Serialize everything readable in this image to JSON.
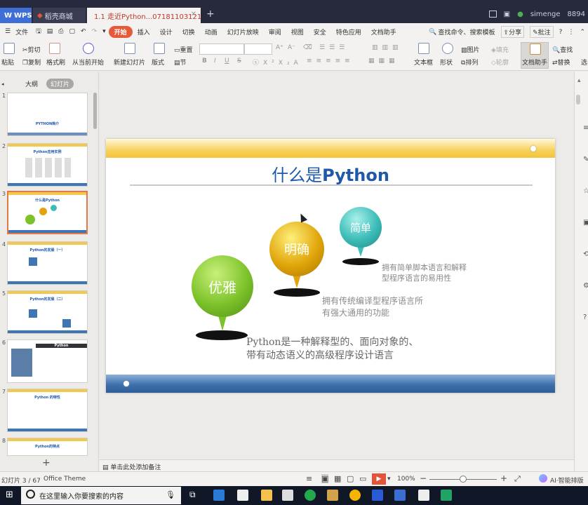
{
  "titlebar": {
    "tabs": [
      {
        "label": "WPS"
      },
      {
        "label": "稻壳商城"
      },
      {
        "label": "1.1 走近Python...07181103121"
      }
    ],
    "new_tab": "+",
    "user": "simenge",
    "user_id": "8894"
  },
  "menubar": {
    "file": "文件",
    "items": [
      "开始",
      "插入",
      "设计",
      "切换",
      "动画",
      "幻灯片放映",
      "审阅",
      "视图",
      "安全",
      "特色应用",
      "文档助手"
    ],
    "search": "查找命令、搜索模板",
    "share": "分享",
    "comment": "批注",
    "help": "?"
  },
  "ribbon": {
    "paste": "粘贴",
    "cut": "剪切",
    "copy": "复制",
    "format_painter": "格式刷",
    "from_start": "从当前开始",
    "new_slide": "新建幻灯片",
    "layout": "版式",
    "reset": "重置",
    "section": "节",
    "bold": "B",
    "italic": "I",
    "underline": "U",
    "strike": "S",
    "textbox": "文本框",
    "shape": "形状",
    "picture": "图片",
    "arrange": "排列",
    "fill": "填充",
    "outline": "轮廓",
    "doc_helper": "文档助手",
    "find": "查找",
    "replace": "替换",
    "more": "选"
  },
  "leftpanel": {
    "tab_outline": "大纲",
    "tab_slides": "幻灯片",
    "add": "+",
    "thumbs": [
      {
        "num": "1",
        "title": "PYTHON简介"
      },
      {
        "num": "2",
        "title": "Python应用实例"
      },
      {
        "num": "3",
        "title": "什么是Python"
      },
      {
        "num": "4",
        "title": "Python的发展（一）"
      },
      {
        "num": "5",
        "title": "Python的发展（二）"
      },
      {
        "num": "6",
        "title": "Python"
      },
      {
        "num": "7",
        "title": "Python 的特性"
      },
      {
        "num": "8",
        "title": "Python的特点"
      }
    ]
  },
  "slide": {
    "title_cn": "什么是",
    "title_en": "Python",
    "pins": [
      {
        "label": "优雅",
        "color": "#7cc22a"
      },
      {
        "label": "明确",
        "color": "#e0a50a"
      },
      {
        "label": "简单",
        "color": "#3cbcb7"
      }
    ],
    "captions": {
      "simple_1": "拥有简单脚本语言和解释",
      "simple_2": "型程序语言的易用性",
      "clear_1": "拥有传统编译型程序语言所",
      "clear_2": "有强大通用的功能"
    },
    "main_1": "Python是一种解释型的、面向对象的、",
    "main_2": "带有动态语义的高级程序设计语言"
  },
  "notes": {
    "placeholder": "单击此处添加备注"
  },
  "status": {
    "slide_count": "幻灯片 3 / 67",
    "theme": "Office Theme",
    "zoom": "100%",
    "minus": "−",
    "plus": "+",
    "ai": "AI·智能排版"
  },
  "taskbar": {
    "search": "在这里输入你要搜索的内容"
  }
}
